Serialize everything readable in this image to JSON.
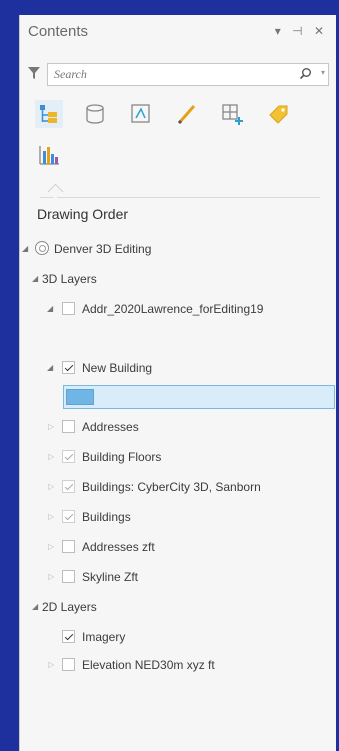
{
  "pane": {
    "title": "Contents",
    "controls": "▾ ⊣ ✕"
  },
  "search": {
    "placeholder": "Search"
  },
  "toolbar": {
    "tools": [
      "list-by-drawing-order-icon",
      "list-by-source-icon",
      "list-by-selection-icon",
      "list-by-editing-icon",
      "list-by-snapping-icon",
      "list-by-labeling-icon",
      "list-by-charts-icon"
    ]
  },
  "section": {
    "title": "Drawing Order"
  },
  "tree": {
    "map": "Denver 3D Editing",
    "group_3d": "3D Layers",
    "addr": "Addr_2020Lawrence_forEditing19",
    "new_building": "New Building",
    "addresses": "Addresses",
    "building_floors": "Building Floors",
    "buildings_cybercity": "Buildings: CyberCity 3D, Sanborn",
    "buildings": "Buildings",
    "addresses_zft": "Addresses zft",
    "skyline": "Skyline Zft",
    "group_2d": "2D Layers",
    "imagery": "Imagery",
    "elevation": "Elevation NED30m xyz ft"
  },
  "colors": {
    "background": "#1e2f9e",
    "selection": "#d8ecfa",
    "symbol_fill": "#6fb6e6"
  }
}
